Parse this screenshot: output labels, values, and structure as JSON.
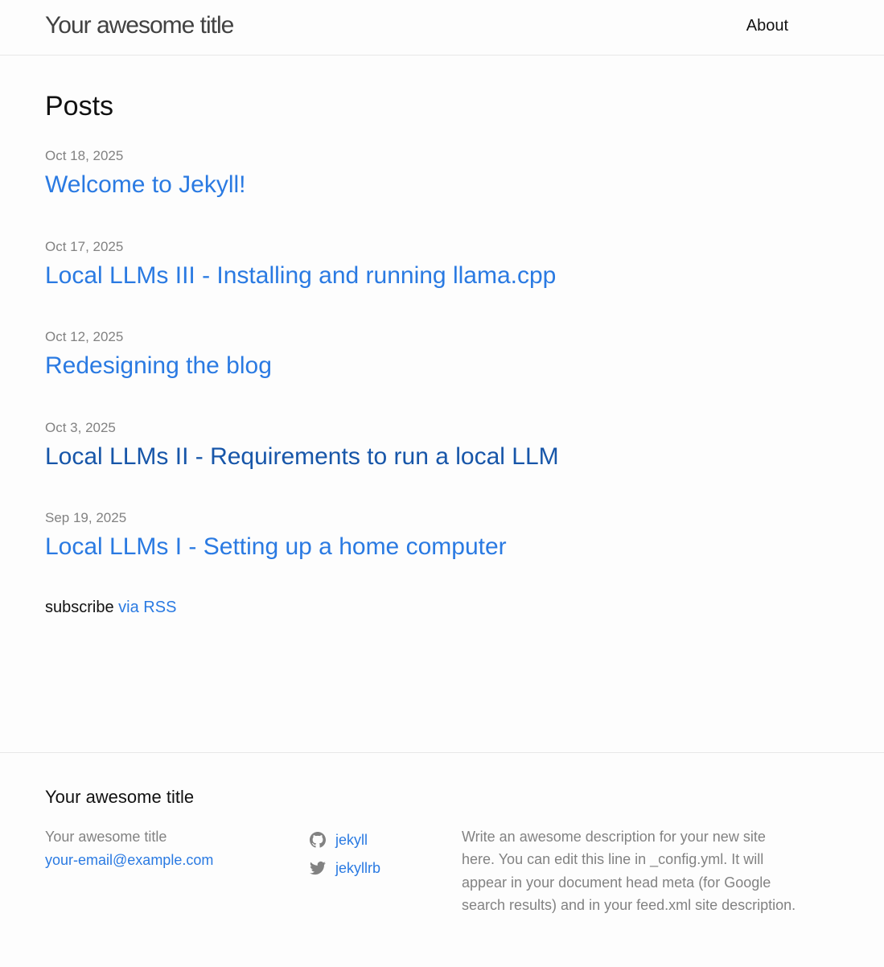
{
  "header": {
    "site_title": "Your awesome title",
    "nav": {
      "about": "About"
    }
  },
  "main": {
    "heading": "Posts",
    "posts": [
      {
        "date": "Oct 18, 2025",
        "title": "Welcome to Jekyll!"
      },
      {
        "date": "Oct 17, 2025",
        "title": "Local LLMs III - Installing and running llama.cpp"
      },
      {
        "date": "Oct 12, 2025",
        "title": "Redesigning the blog"
      },
      {
        "date": "Oct 3, 2025",
        "title": "Local LLMs II - Requirements to run a local LLM"
      },
      {
        "date": "Sep 19, 2025",
        "title": "Local LLMs I - Setting up a home computer"
      }
    ],
    "rss": {
      "prefix": "subscribe",
      "link": "via RSS"
    }
  },
  "footer": {
    "heading": "Your awesome title",
    "contact": {
      "name": "Your awesome title",
      "email": "your-email@example.com"
    },
    "social": [
      {
        "icon": "github-icon",
        "username": "jekyll"
      },
      {
        "icon": "twitter-icon",
        "username": "jekyllrb"
      }
    ],
    "description": "Write an awesome description for your new site here. You can edit this line in _config.yml. It will appear in your document head meta (for Google search results) and in your feed.xml site description."
  },
  "colors": {
    "link": "#2a7ae2",
    "link_visited": "#1756a9",
    "meta_gray": "#828282",
    "text": "#111111",
    "border": "#e8e8e8",
    "background": "#fdfdfd"
  }
}
